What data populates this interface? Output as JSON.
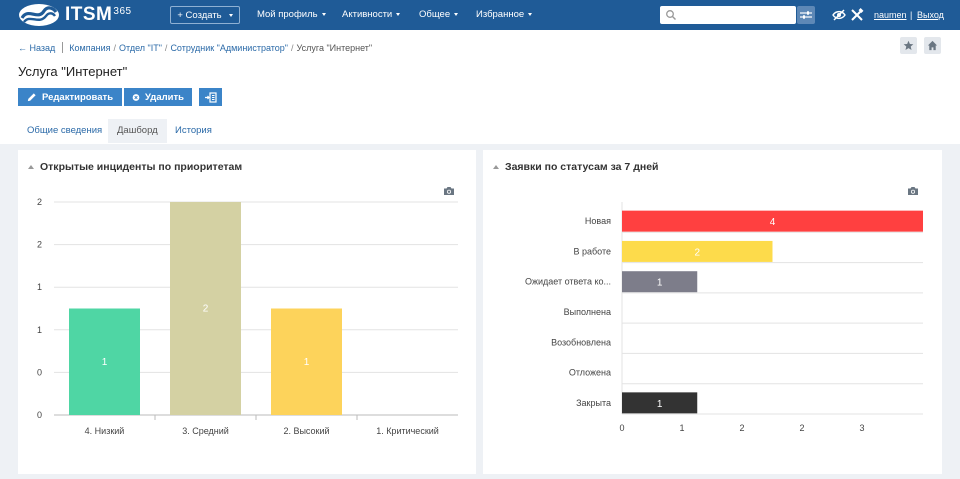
{
  "topbar": {
    "logo_text": "ITSM",
    "logo_sup": "365",
    "create_label": "+ Создать",
    "nav": [
      "Мой профиль",
      "Активности",
      "Общее",
      "Избранное"
    ],
    "search_value": "",
    "search_placeholder": "",
    "user": "naumen",
    "separator": "|",
    "logout": "Выход"
  },
  "breadcrumb": {
    "back": "← Назад",
    "items": [
      "Компания",
      "Отдел \"IT\"",
      "Сотрудник \"Администратор\"",
      "Услуга \"Интернет\""
    ],
    "separator": "/"
  },
  "page": {
    "title": "Услуга \"Интернет\"",
    "edit_label": "Редактировать",
    "delete_label": "Удалить"
  },
  "tabs": [
    "Общие сведения",
    "Дашборд",
    "История"
  ],
  "active_tab": 1,
  "colors": {
    "topbar": "#1f5b97",
    "accent": "#3b84c8",
    "low": "#4fd6a4",
    "medium": "#d4d1a3",
    "high": "#fdd35b",
    "new": "#ff4040",
    "in_progress": "#fddb4b",
    "waiting": "#7d7d8a",
    "closed": "#333333"
  },
  "panels": [
    {
      "title": "Открытые инциденты по приоритетам"
    },
    {
      "title": "Заявки по статусам за 7 дней"
    }
  ],
  "chart_data": [
    {
      "type": "bar",
      "title": "Открытые инциденты по приоритетам",
      "categories": [
        "4. Низкий",
        "3. Средний",
        "2. Высокий",
        "1. Критический"
      ],
      "values": [
        1,
        2,
        1,
        0
      ],
      "data_labels": [
        "1",
        "2",
        "1",
        ""
      ],
      "bar_colors": [
        "#4fd6a4",
        "#d4d1a3",
        "#fdd35b",
        ""
      ],
      "y_tick_labels": [
        "0",
        "0",
        "1",
        "1",
        "2",
        "2"
      ],
      "ylim": [
        0,
        2
      ],
      "grid": true
    },
    {
      "type": "bar",
      "orientation": "horizontal",
      "title": "Заявки по статусам за 7 дней",
      "categories": [
        "Новая",
        "В работе",
        "Ожидает ответа ко...",
        "Выполнена",
        "Возобновлена",
        "Отложена",
        "Закрыта"
      ],
      "values": [
        4,
        2,
        1,
        0,
        0,
        0,
        1
      ],
      "data_labels": [
        "4",
        "2",
        "1",
        "",
        "",
        "",
        "1"
      ],
      "bar_colors": [
        "#ff4040",
        "#fddb4b",
        "#7d7d8a",
        "",
        "",
        "",
        "#333333"
      ],
      "x_tick_labels": [
        "0",
        "1",
        "2",
        "2",
        "3"
      ],
      "xlim": [
        0,
        4
      ],
      "grid": true
    }
  ]
}
